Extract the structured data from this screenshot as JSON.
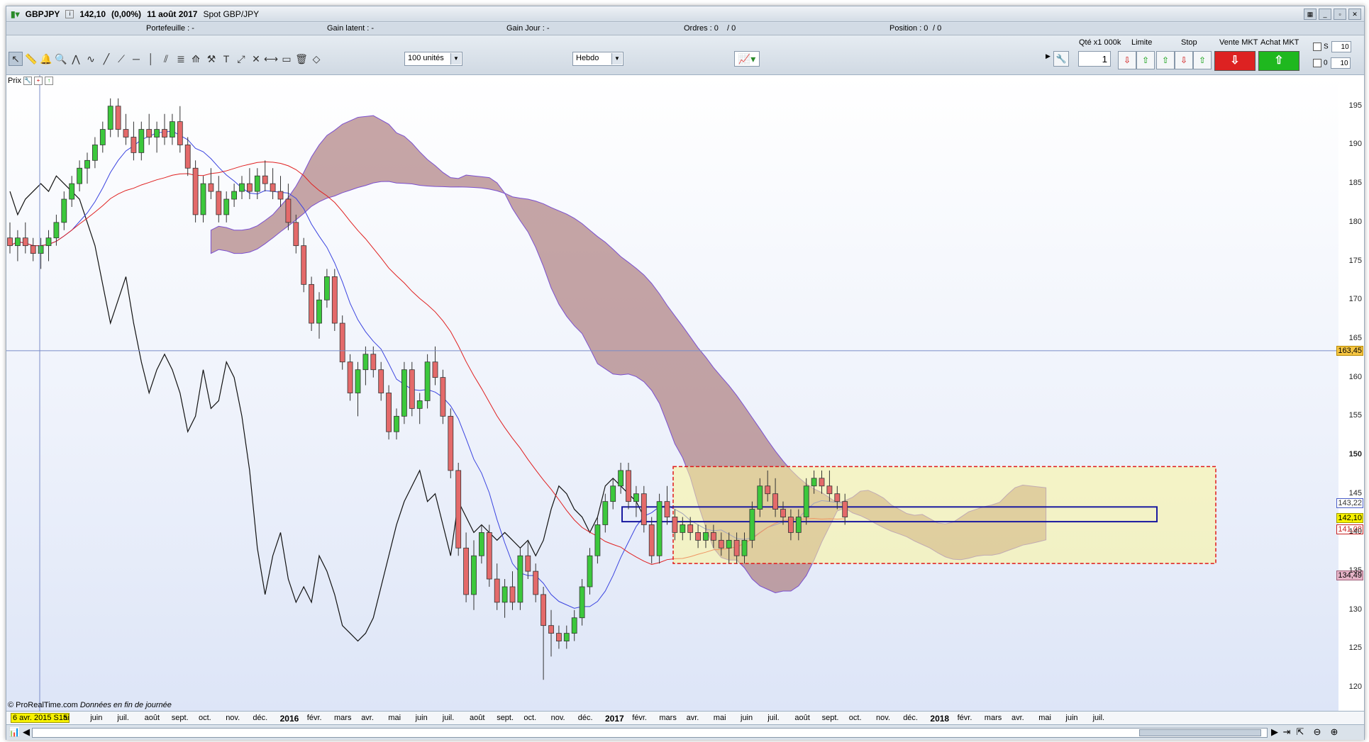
{
  "window": {
    "symbol": "GBPJPY",
    "price": "142,10",
    "change": "(0,00%)",
    "date": "11 août 2017",
    "instrument": "Spot GBP/JPY"
  },
  "infobar": {
    "portefeuille": "Portefeuille : -",
    "gain_latent": "Gain latent : -",
    "gain_jour": "Gain Jour : -",
    "ordres": "Ordres : 0",
    "ordres2": "/ 0",
    "position": "Position : 0",
    "position2": "/ 0"
  },
  "toolbar": {
    "units": "100 unités",
    "period": "Hebdo"
  },
  "order_panel": {
    "qty_label": "Qté x1 000k",
    "qty_value": "1",
    "limite_label": "Limite",
    "stop_label": "Stop",
    "vente_label": "Vente MKT",
    "achat_label": "Achat MKT",
    "s_label": "S",
    "o_label": "0",
    "s_value": "10",
    "o_value": "10"
  },
  "chart_panel": {
    "label": "Prix",
    "copyright": "© ProRealTime.com",
    "copyright_note": "Données en fin de journée",
    "date_tag": "6 avr. 2015 S15"
  },
  "price_tags": {
    "cursor": "163,45",
    "upper": "143,22",
    "current": "142,10",
    "lower": "141,08",
    "cloud": "134,49"
  },
  "chart_data": {
    "type": "candlestick",
    "title": "",
    "ylim": [
      117,
      199
    ],
    "y_ticks": [
      120,
      125,
      130,
      135,
      140,
      145,
      150,
      155,
      160,
      165,
      170,
      175,
      180,
      185,
      190,
      195
    ],
    "y_tick_labels": [
      "120",
      "125",
      "130",
      "135",
      "140",
      "145",
      "150",
      "155",
      "160",
      "165",
      "170",
      "175",
      "180",
      "185",
      "190",
      "195"
    ],
    "x_labels": [
      "ai",
      "juin",
      "juil.",
      "août",
      "sept.",
      "oct.",
      "nov.",
      "déc.",
      "2016",
      "févr.",
      "mars",
      "avr.",
      "mai",
      "juin",
      "juil.",
      "août",
      "sept.",
      "oct.",
      "nov.",
      "déc.",
      "2017",
      "févr.",
      "mars",
      "avr.",
      "mai",
      "juin",
      "juil.",
      "août",
      "sept.",
      "oct.",
      "nov.",
      "déc.",
      "2018",
      "févr.",
      "mars",
      "avr.",
      "mai",
      "juin",
      "juil."
    ],
    "x_bold": [
      "2016",
      "2017",
      "2018"
    ],
    "candles": [
      [
        178,
        180,
        176,
        177
      ],
      [
        177,
        179,
        175,
        178
      ],
      [
        178,
        180,
        176,
        177
      ],
      [
        177,
        178,
        175,
        176
      ],
      [
        176,
        178,
        174,
        177
      ],
      [
        177,
        179,
        175,
        178
      ],
      [
        178,
        181,
        177,
        180
      ],
      [
        180,
        184,
        179,
        183
      ],
      [
        183,
        186,
        182,
        185
      ],
      [
        185,
        188,
        184,
        187
      ],
      [
        187,
        189,
        185,
        188
      ],
      [
        188,
        191,
        187,
        190
      ],
      [
        190,
        193,
        189,
        192
      ],
      [
        192,
        196,
        191,
        195
      ],
      [
        195,
        196,
        191,
        192
      ],
      [
        192,
        194,
        190,
        191
      ],
      [
        191,
        193,
        188,
        189
      ],
      [
        189,
        193,
        188,
        192
      ],
      [
        192,
        194,
        190,
        191
      ],
      [
        191,
        193,
        189,
        192
      ],
      [
        192,
        194,
        190,
        191
      ],
      [
        191,
        194,
        190,
        193
      ],
      [
        193,
        195,
        189,
        190
      ],
      [
        190,
        191,
        186,
        187
      ],
      [
        187,
        188,
        180,
        181
      ],
      [
        181,
        186,
        180,
        185
      ],
      [
        185,
        187,
        183,
        184
      ],
      [
        184,
        186,
        180,
        181
      ],
      [
        181,
        184,
        180,
        183
      ],
      [
        183,
        185,
        182,
        184
      ],
      [
        184,
        186,
        183,
        185
      ],
      [
        185,
        187,
        183,
        184
      ],
      [
        184,
        187,
        183,
        186
      ],
      [
        186,
        188,
        184,
        185
      ],
      [
        185,
        187,
        183,
        184
      ],
      [
        184,
        186,
        182,
        183
      ],
      [
        183,
        185,
        179,
        180
      ],
      [
        180,
        181,
        176,
        177
      ],
      [
        177,
        178,
        171,
        172
      ],
      [
        172,
        173,
        166,
        167
      ],
      [
        167,
        171,
        165,
        170
      ],
      [
        170,
        174,
        169,
        173
      ],
      [
        173,
        174,
        166,
        167
      ],
      [
        167,
        168,
        161,
        162
      ],
      [
        162,
        163,
        157,
        158
      ],
      [
        158,
        162,
        155,
        161
      ],
      [
        161,
        164,
        159,
        163
      ],
      [
        163,
        164,
        160,
        161
      ],
      [
        161,
        162,
        157,
        158
      ],
      [
        158,
        159,
        152,
        153
      ],
      [
        153,
        156,
        152,
        155
      ],
      [
        155,
        162,
        154,
        161
      ],
      [
        161,
        162,
        155,
        156
      ],
      [
        156,
        158,
        154,
        157
      ],
      [
        157,
        163,
        156,
        162
      ],
      [
        162,
        164,
        159,
        160
      ],
      [
        160,
        161,
        154,
        155
      ],
      [
        155,
        156,
        147,
        148
      ],
      [
        148,
        149,
        137,
        138
      ],
      [
        138,
        140,
        131,
        132
      ],
      [
        132,
        139,
        130,
        137
      ],
      [
        137,
        141,
        136,
        140
      ],
      [
        140,
        141,
        133,
        134
      ],
      [
        134,
        136,
        130,
        131
      ],
      [
        131,
        134,
        129,
        133
      ],
      [
        133,
        135,
        130,
        131
      ],
      [
        131,
        138,
        130,
        137
      ],
      [
        137,
        139,
        134,
        135
      ],
      [
        135,
        136,
        131,
        132
      ],
      [
        132,
        133,
        121,
        128
      ],
      [
        128,
        130,
        124,
        127
      ],
      [
        127,
        128,
        125,
        126
      ],
      [
        126,
        128,
        125,
        127
      ],
      [
        127,
        130,
        126,
        129
      ],
      [
        129,
        134,
        128,
        133
      ],
      [
        133,
        138,
        132,
        137
      ],
      [
        137,
        142,
        136,
        141
      ],
      [
        141,
        145,
        140,
        144
      ],
      [
        144,
        147,
        143,
        146
      ],
      [
        146,
        149,
        145,
        148
      ],
      [
        148,
        149,
        143,
        144
      ],
      [
        144,
        146,
        142,
        145
      ],
      [
        145,
        146,
        140,
        141
      ],
      [
        141,
        142,
        136,
        137
      ],
      [
        137,
        145,
        136,
        144
      ],
      [
        144,
        146,
        141,
        142
      ],
      [
        142,
        143,
        139,
        140
      ],
      [
        140,
        142,
        139,
        141
      ],
      [
        141,
        142,
        139,
        140
      ],
      [
        140,
        141,
        138,
        139
      ],
      [
        139,
        141,
        138,
        140
      ],
      [
        140,
        141,
        138,
        139
      ],
      [
        139,
        140,
        137,
        138
      ],
      [
        138,
        140,
        136,
        139
      ],
      [
        139,
        140,
        136,
        137
      ],
      [
        137,
        140,
        136,
        139
      ],
      [
        139,
        144,
        138,
        143
      ],
      [
        143,
        147,
        142,
        146
      ],
      [
        146,
        148,
        144,
        145
      ],
      [
        145,
        147,
        142,
        143
      ],
      [
        143,
        144,
        141,
        142
      ],
      [
        142,
        143,
        139,
        140
      ],
      [
        140,
        143,
        139,
        142
      ],
      [
        142,
        147,
        141,
        146
      ],
      [
        146,
        148,
        145,
        147
      ],
      [
        147,
        148,
        145,
        146
      ],
      [
        146,
        148,
        144,
        145
      ],
      [
        145,
        146,
        143,
        144
      ],
      [
        144,
        145,
        141,
        142
      ]
    ]
  }
}
